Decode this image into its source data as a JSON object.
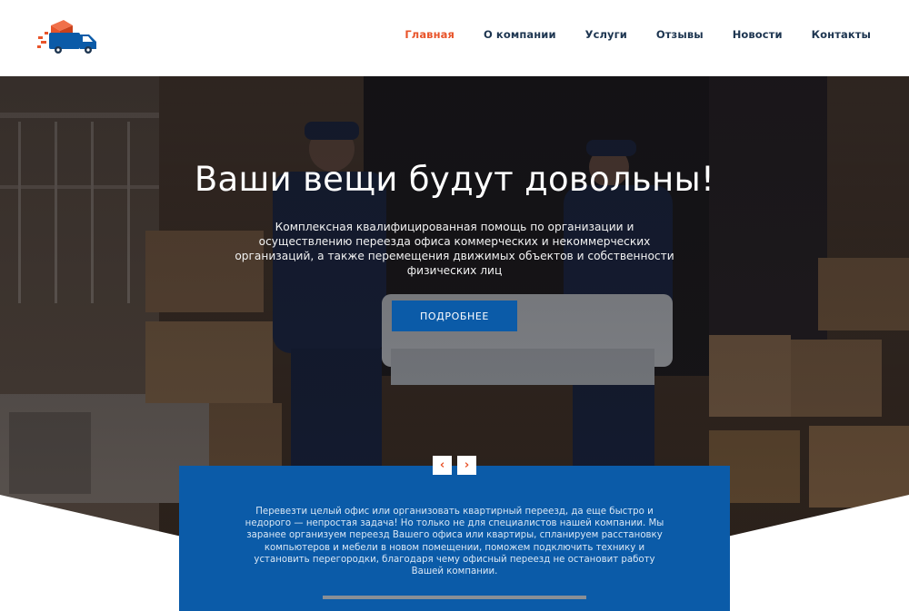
{
  "nav": {
    "items": [
      {
        "label": "Главная",
        "active": true
      },
      {
        "label": "О компании",
        "active": false
      },
      {
        "label": "Услуги",
        "active": false
      },
      {
        "label": "Отзывы",
        "active": false
      },
      {
        "label": "Новости",
        "active": false
      },
      {
        "label": "Контакты",
        "active": false
      }
    ]
  },
  "logo": {
    "icon": "delivery-truck-icon"
  },
  "hero": {
    "title": "Ваши вещи будут довольны!",
    "subtitle": "Комплексная квалифицированная помощь по организации и осуществлению переезда офиса коммерческих и некоммерческих организаций, а также перемещения движимых объектов и собственности физических лиц",
    "button": "ПОДРОБНЕЕ"
  },
  "slider": {
    "prev_icon": "chevron-left-icon",
    "next_icon": "chevron-right-icon",
    "prev_glyph": "‹",
    "next_glyph": "›"
  },
  "info": {
    "text": "Перевезти целый офис или организовать квартирный переезд, да еще быстро и недорого — непростая задача! Но только не для специалистов нашей компании. Мы заранее организуем переезд Вашего офиса или квартиры, спланируем расстановку компьютеров и мебели в новом помещении, поможем подключить технику и установить перегородки, благодаря чему офисный переезд не остановит работу Вашей компании."
  },
  "colors": {
    "accent": "#e8542a",
    "brand_blue": "#0b5ba8",
    "nav_text": "#1d3550"
  }
}
